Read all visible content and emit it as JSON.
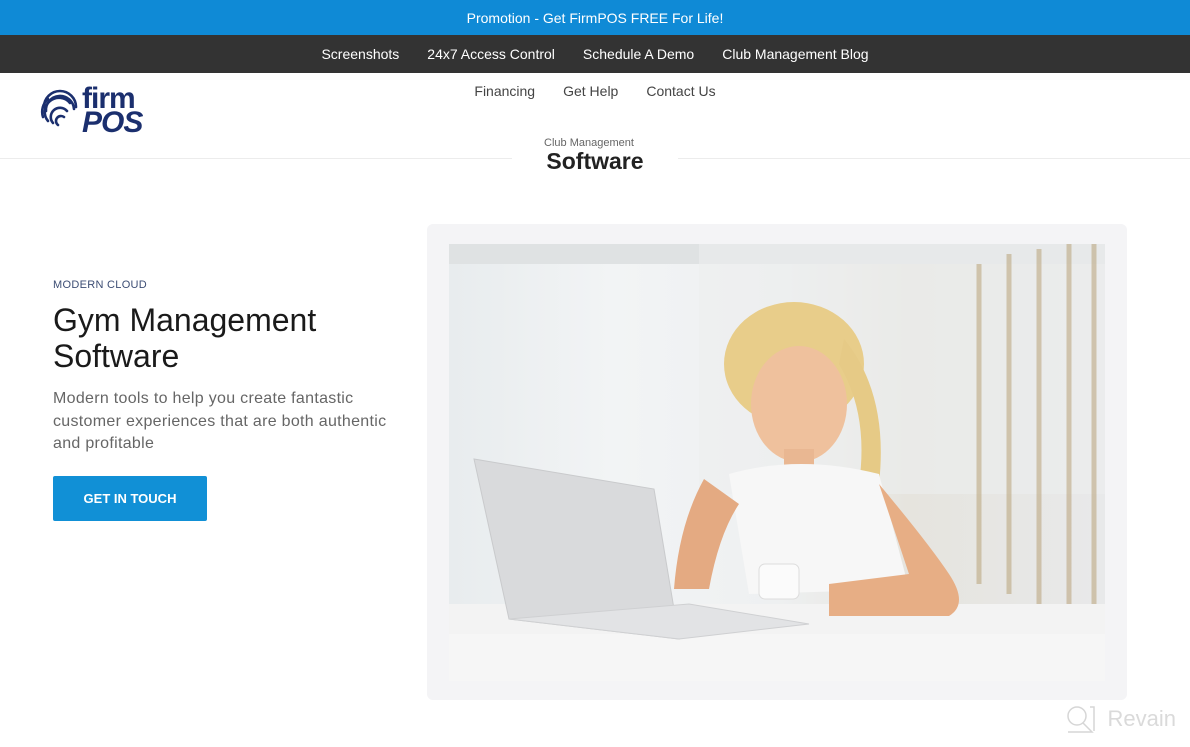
{
  "promo": {
    "text": "Promotion - Get FirmPOS FREE For Life!"
  },
  "top_nav": {
    "items": [
      {
        "label": "Screenshots"
      },
      {
        "label": "24x7 Access Control"
      },
      {
        "label": "Schedule A Demo"
      },
      {
        "label": "Club Management Blog"
      }
    ]
  },
  "header": {
    "logo": {
      "line1": "firm",
      "line2": "POS",
      "icon": "fingerprint-icon"
    },
    "sub_nav": [
      {
        "label": "Financing"
      },
      {
        "label": "Get Help"
      },
      {
        "label": "Contact Us"
      }
    ],
    "section_title": {
      "small": "Club Management",
      "big": "Software"
    }
  },
  "hero": {
    "eyebrow": "MODERN CLOUD",
    "title_line1": "Gym Management",
    "title_line2": "Software",
    "description": "Modern tools to help you create fantastic customer experiences that are both authentic and profitable",
    "cta_label": "GET IN TOUCH",
    "image_alt": "Woman smiling at laptop holding a cup in a bright gym"
  },
  "watermark": {
    "text": "Revain",
    "icon": "revain-logo-icon"
  },
  "colors": {
    "promo": "#0f8ad6",
    "nav": "#333333",
    "brand": "#1b2f6e",
    "cta": "#1190d6"
  }
}
